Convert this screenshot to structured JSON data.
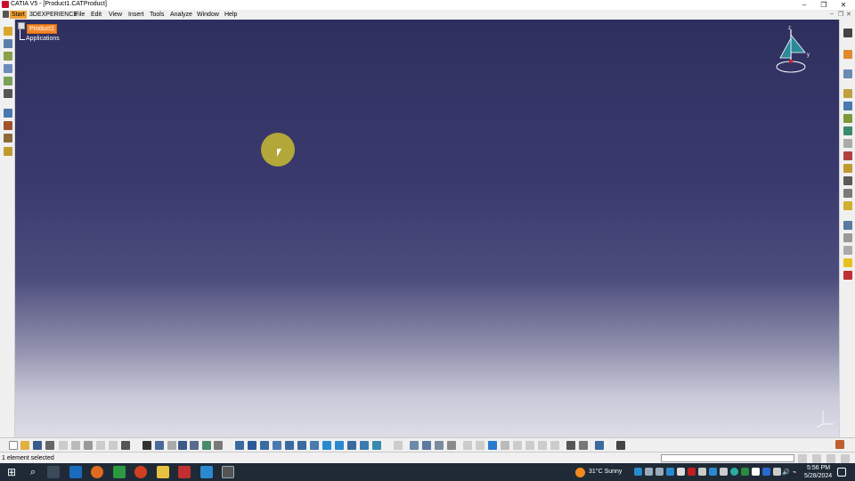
{
  "window": {
    "title": "CATIA V5 - [Product1.CATProduct]",
    "controls": {
      "minimize": "–",
      "maximize": "❐",
      "close": "✕"
    }
  },
  "menu": {
    "items": [
      "Start",
      "3DEXPERIENCE",
      "File",
      "Edit",
      "View",
      "Insert",
      "Tools",
      "Analyze",
      "Window",
      "Help"
    ],
    "mdi_controls": [
      "–",
      "❐",
      "✕"
    ]
  },
  "tree": {
    "root": "Product1",
    "child": "Applications"
  },
  "compass": {
    "x_label": "x",
    "y_label": "y",
    "z_label": "z"
  },
  "status_bar": {
    "text": "1 element selected",
    "command_input": ""
  },
  "taskbar": {
    "weather": "31°C  Sunny",
    "time": "5:56 PM",
    "date": "5/28/2024"
  },
  "colors": {
    "selection": "#f4872b",
    "viewport_top": "#2f2f5f",
    "viewport_bottom": "#dedee8",
    "taskbar": "#1f2a36"
  }
}
